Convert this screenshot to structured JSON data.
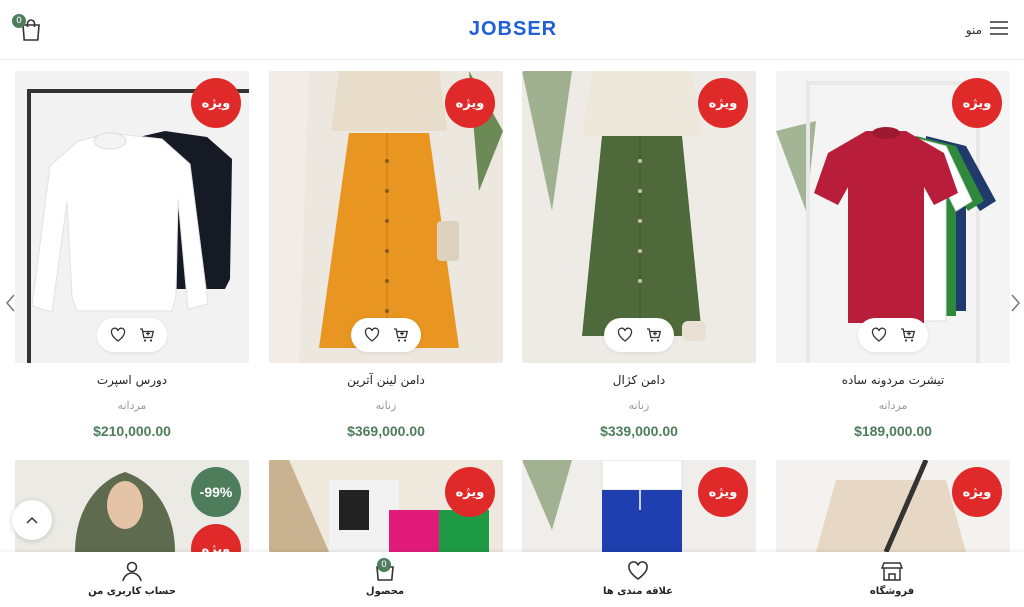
{
  "header": {
    "logo_text": "JOBSER",
    "menu_label": "منو",
    "cart_count": "0"
  },
  "colors": {
    "accent_green": "#4e7d5c",
    "badge_red": "#e02a2a",
    "logo_blue": "#1f5fd8"
  },
  "products_row1": [
    {
      "title": "تیشرت مردونه ساده",
      "category": "مردانه",
      "price": "$189,000.00",
      "badge": "ویژه",
      "icon": "red-tshirt-image"
    },
    {
      "title": "دامن کژال",
      "category": "زنانه",
      "price": "$339,000.00",
      "badge": "ویژه",
      "icon": "green-skirt-image"
    },
    {
      "title": "دامن لینن آترین",
      "category": "زنانه",
      "price": "$369,000.00",
      "badge": "ویژه",
      "icon": "orange-skirt-image"
    },
    {
      "title": "دورس اسپرت",
      "category": "مردانه",
      "price": "$210,000.00",
      "badge": "ویژه",
      "icon": "sweatshirt-image"
    }
  ],
  "products_row2": [
    {
      "badge": "ویژه",
      "icon": "beige-top-image"
    },
    {
      "badge": "ویژه",
      "icon": "blue-pants-image"
    },
    {
      "badge": "ویژه",
      "icon": "colorful-pants-image"
    },
    {
      "badge": "-99%",
      "badge2": "ویژه",
      "icon": "hijab-model-image"
    }
  ],
  "bottom_nav": {
    "shop": "فروشگاه",
    "wishlist": "علاقه مندی ها",
    "product": "محصول",
    "account": "حساب کاربری من",
    "product_count": "0"
  }
}
